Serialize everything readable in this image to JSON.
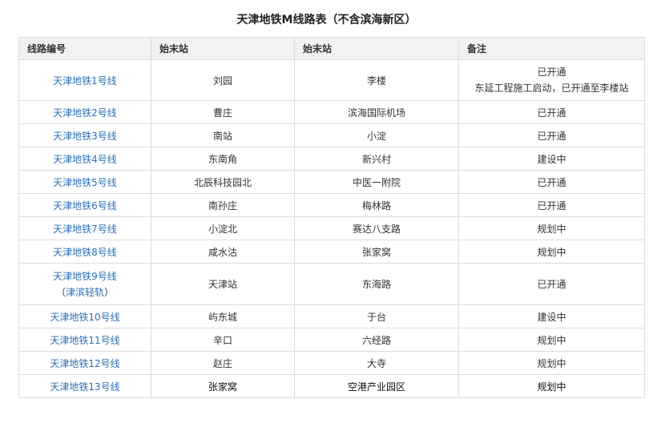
{
  "title": "天津地铁M线路表（不含滨海新区）",
  "headers": [
    "线路编号",
    "始末站",
    "始末站",
    "备注"
  ],
  "rows": [
    {
      "line": "天津地铁1号线",
      "start": "刘园",
      "end": "李楼",
      "note": "已开通",
      "note2": "东延工程施工启动，已开通至李楼站"
    },
    {
      "line": "天津地铁2号线",
      "start": "曹庄",
      "end": "滨海国际机场",
      "note": "已开通"
    },
    {
      "line": "天津地铁3号线",
      "start": "南站",
      "end": "小淀",
      "note": "已开通"
    },
    {
      "line": "天津地铁4号线",
      "start": "东南角",
      "end": "新兴村",
      "note": "建设中"
    },
    {
      "line": "天津地铁5号线",
      "start": "北辰科技园北",
      "end": "中医一附院",
      "note": "已开通"
    },
    {
      "line": "天津地铁6号线",
      "start": "南孙庄",
      "end": "梅林路",
      "note": "已开通"
    },
    {
      "line": "天津地铁7号线",
      "start": "小淀北",
      "end": "赛达八支路",
      "note": "规划中"
    },
    {
      "line": "天津地铁8号线",
      "start": "咸水沽",
      "end": "张家窝",
      "note": "规划中"
    },
    {
      "line": "天津地铁9号线",
      "line_sub_open": "（",
      "line_sub": "津滨轻轨",
      "line_sub_close": "）",
      "start": "天津站",
      "end": "东海路",
      "note": "已开通"
    },
    {
      "line": "天津地铁10号线",
      "start": "屿东城",
      "end": "于台",
      "note": "建设中"
    },
    {
      "line": "天津地铁11号线",
      "start": "辛口",
      "end": "六经路",
      "note": "规划中"
    },
    {
      "line": "天津地铁12号线",
      "start": "赵庄",
      "end": "大寺",
      "note": "规划中"
    },
    {
      "line": "天津地铁13号线",
      "start": "张家窝",
      "end": "空港产业园区",
      "note": "规划中"
    }
  ]
}
